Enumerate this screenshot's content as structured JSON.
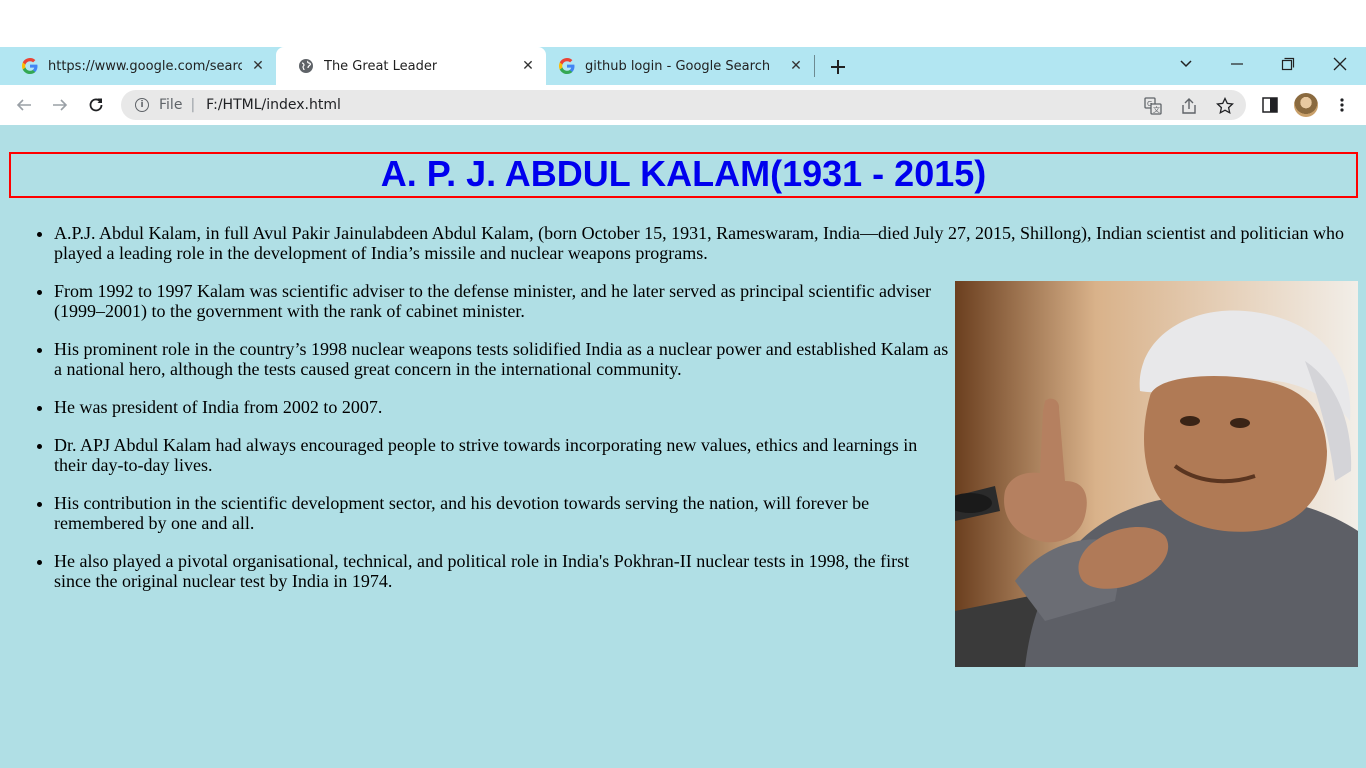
{
  "tabs": [
    {
      "title": "https://www.google.com/search?",
      "icon": "google-icon"
    },
    {
      "title": "The Great Leader",
      "icon": "globe-icon"
    },
    {
      "title": "github login - Google Search",
      "icon": "google-icon"
    }
  ],
  "address": {
    "scheme": "File",
    "path": "F:/HTML/index.html"
  },
  "page": {
    "heading": "A. P. J. ABDUL KALAM(1931 - 2015)",
    "image_alt": "APJ Abdul Kalam portrait",
    "facts": [
      "A.P.J. Abdul Kalam, in full Avul Pakir Jainulabdeen Abdul Kalam, (born October 15, 1931, Rameswaram, India—died July 27, 2015, Shillong), Indian scientist and politician who played a leading role in the development of India’s missile and nuclear weapons programs.",
      "From 1992 to 1997 Kalam was scientific adviser to the defense minister, and he later served as principal scientific adviser (1999–2001) to the government with the rank of cabinet minister.",
      "His prominent role in the country’s 1998 nuclear weapons tests solidified India as a nuclear power and established Kalam as a national hero, although the tests caused great concern in the international community.",
      "He was president of India from 2002 to 2007.",
      "Dr. APJ Abdul Kalam had always encouraged people to strive towards incorporating new values, ethics and learnings in their day-to-day lives.",
      "His contribution in the scientific development sector, and his devotion towards serving the nation, will forever be remembered by one and all.",
      "He also played a pivotal organisational, technical, and political role in India's Pokhran-II nuclear tests in 1998, the first since the original nuclear test by India in 1974."
    ]
  },
  "colors": {
    "tabbar_bg": "#b2e6f2",
    "page_bg": "#b0dfe5",
    "heading_text": "#0000ee",
    "heading_border": "#ff0000"
  }
}
